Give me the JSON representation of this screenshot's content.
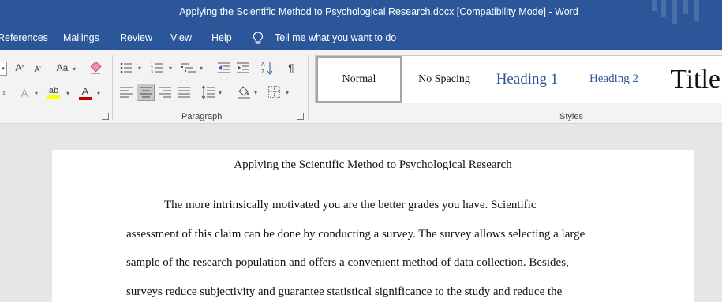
{
  "window": {
    "title": "Applying the Scientific Method to Psychological Research.docx [Compatibility Mode]  -  Word"
  },
  "menu": {
    "tabs": [
      "References",
      "Mailings",
      "Review",
      "View",
      "Help"
    ],
    "tell_me": "Tell me what you want to do"
  },
  "ribbon": {
    "paragraph_label": "Paragraph",
    "styles_label": "Styles",
    "font_case_label": "Aa",
    "styles": [
      "Normal",
      "No Spacing",
      "Heading 1",
      "Heading 2",
      "Title"
    ],
    "selected_style": "Normal",
    "colors": {
      "highlight": "#ffff00",
      "font_color": "#c00000",
      "heading_blue": "#2e5597"
    }
  },
  "document": {
    "title": "Applying the Scientific Method to Psychological Research",
    "lines": [
      "The more intrinsically motivated you are the better grades you have. Scientific",
      "assessment of this claim can be done by conducting a survey. The survey allows selecting a large",
      "sample of the research population and offers a convenient method of data collection. Besides,",
      "surveys reduce subjectivity and guarantee statistical significance to the study and reduce the"
    ]
  }
}
